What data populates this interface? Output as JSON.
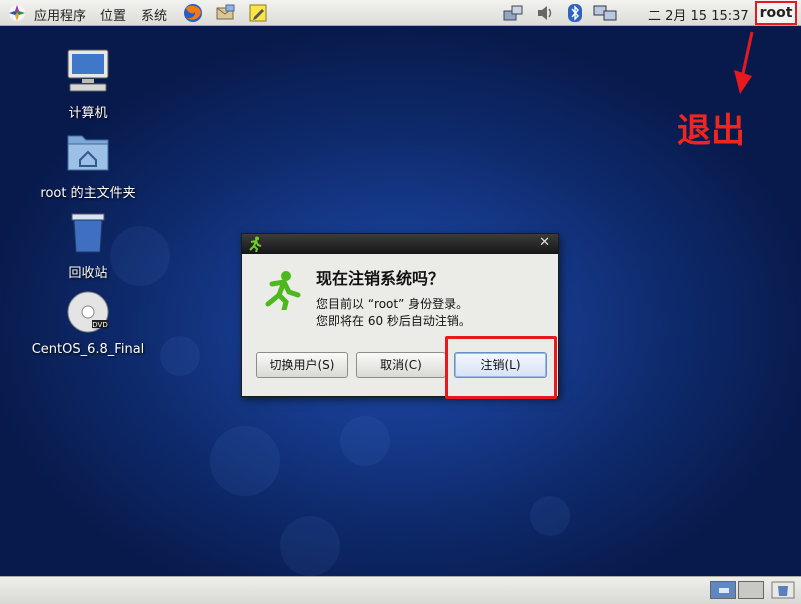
{
  "top_panel": {
    "menus": [
      "应用程序",
      "位置",
      "系统"
    ],
    "clock": "二 2月 15 15:37",
    "user": "root"
  },
  "desktop": {
    "icons": [
      {
        "label": "计算机",
        "icon": "computer-icon"
      },
      {
        "label": "root 的主文件夹",
        "icon": "home-folder-icon"
      },
      {
        "label": "回收站",
        "icon": "trash-icon"
      },
      {
        "label": "CentOS_6.8_Final",
        "icon": "dvd-icon"
      }
    ]
  },
  "annotation": {
    "text": "退出",
    "color": "#e8191e"
  },
  "dialog": {
    "heading": "现在注销系统吗？",
    "message_line1": "您目前以 “root” 身份登录。",
    "message_line2": "您即将在 60 秒后自动注销。",
    "buttons": {
      "switch_user": "切换用户(S)",
      "cancel": "取消(C)",
      "logout": "注销(L)"
    }
  }
}
